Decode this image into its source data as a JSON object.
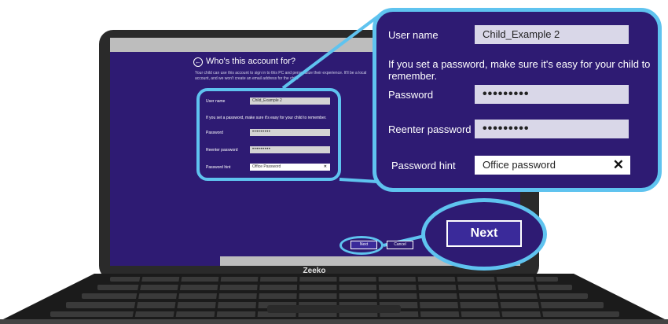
{
  "laptop": {
    "brand": "Zeeko"
  },
  "dialog": {
    "title": "Who's this account for?",
    "description": "Your child can use this account to sign in to this PC and personalize their experience. It'll be a local account, and we won't create an email address for the child.",
    "user_name_label": "User name",
    "user_name_value": "Child_Example 2",
    "hint_text": "If you set a password, make sure it's easy for your child to remember.",
    "password_label": "Password",
    "password_value": "•••••••••",
    "reenter_label": "Reenter password",
    "reenter_value": "•••••••••",
    "password_hint_label": "Password hint",
    "password_hint_value": "Office Password",
    "next_label": "Next",
    "cancel_label": "Cancel"
  },
  "zoom": {
    "user_name_label": "User name",
    "user_name_value": "Child_Example 2",
    "hint_text": "If you set a password, make sure it's easy for your child to remember.",
    "password_label": "Password",
    "password_value": "•••••••••",
    "reenter_label": "Reenter password",
    "reenter_value": "•••••••••",
    "password_hint_label": "Password hint",
    "password_hint_value": "Office password",
    "close_glyph": "✕",
    "next_label": "Next"
  },
  "colors": {
    "screen_bg": "#2e1b73",
    "accent": "#5fc3ef"
  }
}
